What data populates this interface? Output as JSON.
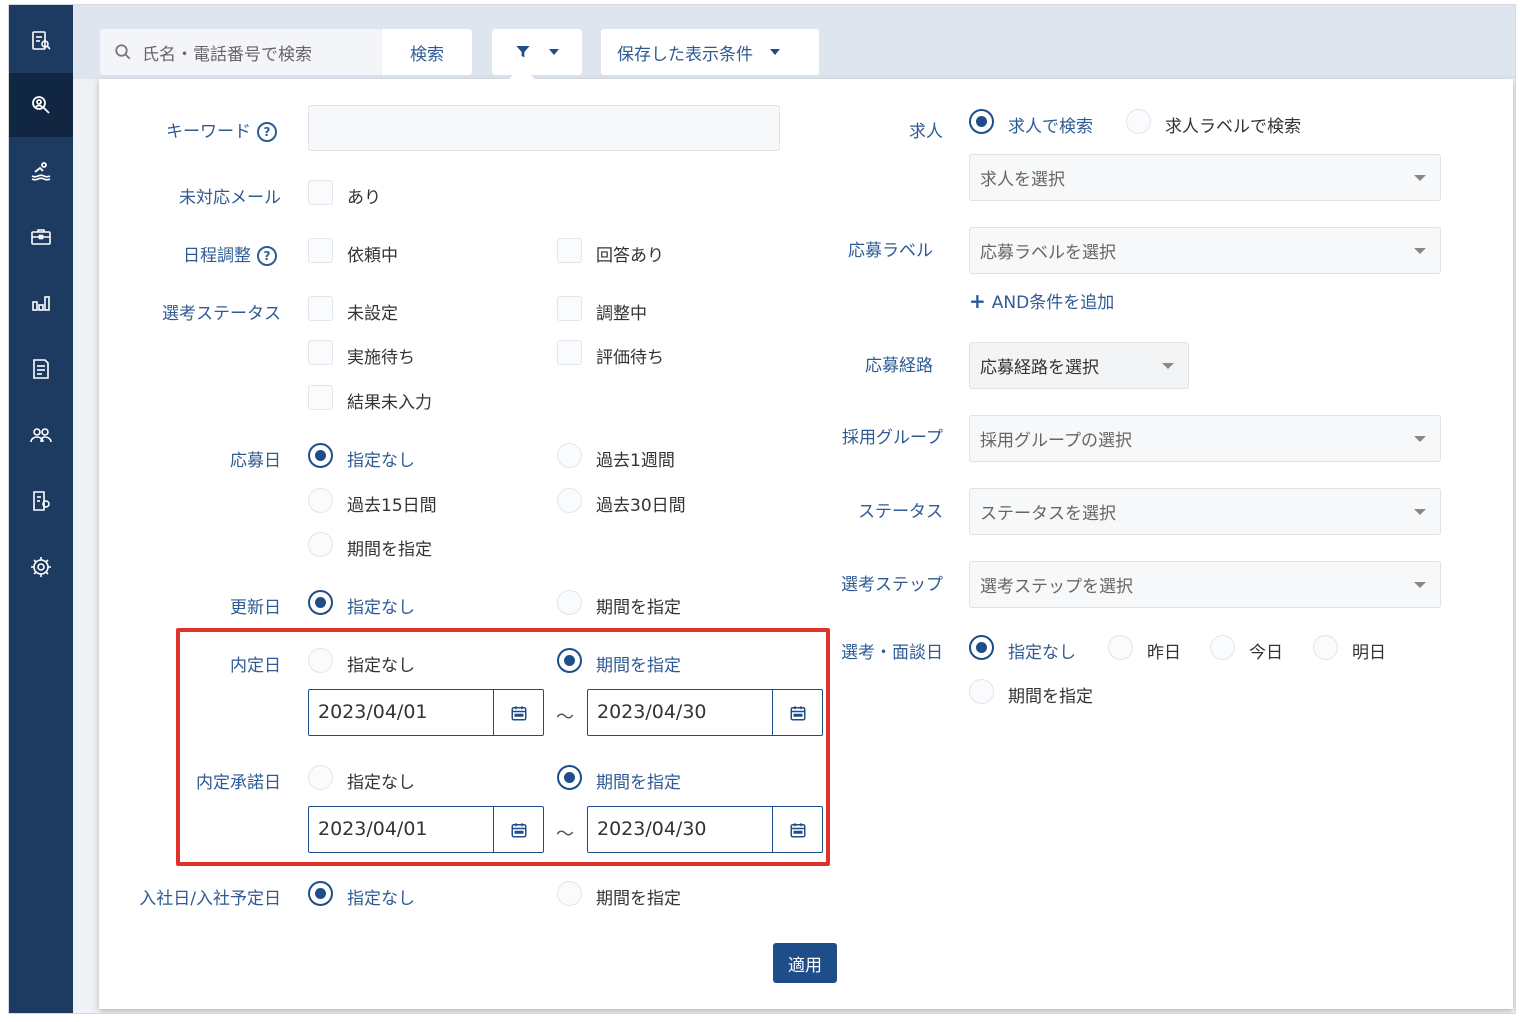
{
  "sidebar": {
    "items": [
      {
        "icon": "document-search-icon"
      },
      {
        "icon": "person-search-icon",
        "active": true
      },
      {
        "icon": "swimmer-icon"
      },
      {
        "icon": "briefcase-icon"
      },
      {
        "icon": "bar-chart-icon"
      },
      {
        "icon": "report-icon"
      },
      {
        "icon": "users-icon"
      },
      {
        "icon": "document-settings-icon"
      },
      {
        "icon": "gear-icon"
      }
    ]
  },
  "search": {
    "placeholder": "氏名・電話番号で検索",
    "button_label": "検索",
    "saved_conditions_label": "保存した表示条件"
  },
  "filter": {
    "keyword": {
      "label": "キーワード",
      "help": "?",
      "value": ""
    },
    "unhandled_mail": {
      "label": "未対応メール",
      "options": [
        "あり"
      ]
    },
    "schedule": {
      "label": "日程調整",
      "help": "?",
      "options": [
        "依頼中",
        "回答あり"
      ]
    },
    "selection_status": {
      "label": "選考ステータス",
      "options": [
        "未設定",
        "調整中",
        "実施待ち",
        "評価待ち",
        "結果未入力"
      ]
    },
    "apply_date": {
      "label": "応募日",
      "options": [
        "指定なし",
        "過去1週間",
        "過去15日間",
        "過去30日間",
        "期間を指定"
      ],
      "selected": "指定なし"
    },
    "update_date": {
      "label": "更新日",
      "options": [
        "指定なし",
        "期間を指定"
      ],
      "selected": "指定なし"
    },
    "offer_date": {
      "label": "内定日",
      "options": [
        "指定なし",
        "期間を指定"
      ],
      "selected": "期間を指定",
      "from": "2023/04/01",
      "to": "2023/04/30"
    },
    "offer_accept_date": {
      "label": "内定承諾日",
      "options": [
        "指定なし",
        "期間を指定"
      ],
      "selected": "期間を指定",
      "from": "2023/04/01",
      "to": "2023/04/30"
    },
    "join_date": {
      "label": "入社日/入社予定日",
      "options": [
        "指定なし",
        "期間を指定"
      ],
      "selected": "指定なし"
    },
    "range_separator": "～",
    "job": {
      "label": "求人",
      "options": [
        "求人で検索",
        "求人ラベルで検索"
      ],
      "selected": "求人で検索",
      "placeholder": "求人を選択"
    },
    "apply_label": {
      "label": "応募ラベル",
      "placeholder": "応募ラベルを選択",
      "add_label": "AND条件を追加"
    },
    "apply_route": {
      "label": "応募経路",
      "placeholder": "応募経路を選択"
    },
    "hiring_group": {
      "label": "採用グループ",
      "placeholder": "採用グループの選択"
    },
    "status": {
      "label": "ステータス",
      "placeholder": "ステータスを選択"
    },
    "selection_step": {
      "label": "選考ステップ",
      "placeholder": "選考ステップを選択"
    },
    "interview_date": {
      "label": "選考・面談日",
      "options": [
        "指定なし",
        "昨日",
        "今日",
        "明日",
        "期間を指定"
      ],
      "selected": "指定なし"
    },
    "apply_button": "適用"
  },
  "colors": {
    "sidebar": "#1d3a60",
    "accent": "#1f4d8a",
    "highlight": "#e0322b"
  }
}
